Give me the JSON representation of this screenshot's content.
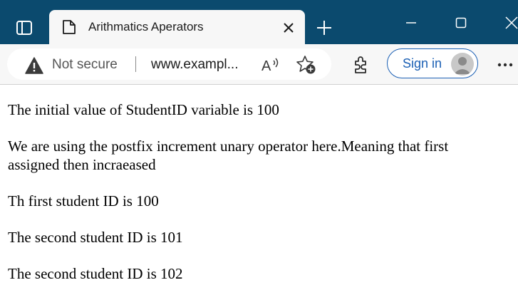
{
  "browser": {
    "tab": {
      "title": "Arithmatics Aperators"
    },
    "address_bar": {
      "security_label": "Not secure",
      "url_display": "www.exampl..."
    },
    "toolbar": {
      "sign_in_label": "Sign in"
    },
    "icons": {
      "tab_actions": "tab-actions-icon",
      "favicon": "page-icon",
      "tab_close": "close-icon",
      "new_tab": "plus-icon",
      "minimize": "minimize-icon",
      "maximize": "maximize-icon",
      "window_close": "close-icon",
      "warning": "warning-icon",
      "read_aloud": "read-aloud-icon",
      "favorites": "add-favorite-icon",
      "extensions": "extensions-icon",
      "profile": "profile-avatar-icon",
      "more": "more-icon"
    },
    "colors": {
      "titlebar": "#0b4a6e",
      "toolbar": "#f7f7f7",
      "accent": "#1a5fb4"
    }
  },
  "page": {
    "lines": [
      "The initial value of StudentID variable is 100",
      "We are using the postfix increment unary operator here.Meaning that first assigned then incraeased",
      "Th first student ID is 100",
      "The second student ID is 101",
      "The second student ID is 102"
    ]
  }
}
